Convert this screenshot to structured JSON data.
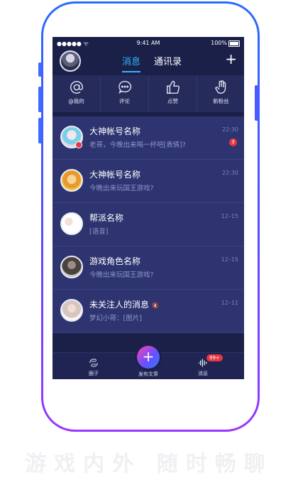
{
  "status": {
    "signal": "●●●●● ᯤ",
    "time": "9:41 AM",
    "battery": "100%"
  },
  "header": {
    "tabs": [
      {
        "label": "消息",
        "active": true
      },
      {
        "label": "通讯录",
        "active": false
      }
    ],
    "add_icon": "plus-icon"
  },
  "quick": [
    {
      "label": "@我的",
      "icon": "at-icon"
    },
    {
      "label": "评论",
      "icon": "comment-icon"
    },
    {
      "label": "点赞",
      "icon": "thumbs-up-icon"
    },
    {
      "label": "新粉丝",
      "icon": "hand-icon"
    }
  ],
  "chats": [
    {
      "name": "大神帐号名称",
      "message": "老哥，今晚出来喝一杯吧[表情]?",
      "time": "22:30",
      "unread": "3"
    },
    {
      "name": "大神帐号名称",
      "message": "今晚出来玩国王游戏?",
      "time": "22:30"
    },
    {
      "name": "帮派名称",
      "message": "[语音]",
      "time": "12–15"
    },
    {
      "name": "游戏角色名称",
      "message": "今晚出来玩国王游戏?",
      "time": "12–15"
    },
    {
      "name": "未关注人的消息",
      "message": "梦幻小哥：[图片]",
      "time": "12–11"
    }
  ],
  "bottom_nav": {
    "circle": "圈子",
    "post": "发布文章",
    "messages": "消息",
    "messages_badge": "99+"
  },
  "slogan": "游戏内外 随时畅聊",
  "colors": {
    "accent": "#31b5ff",
    "background": "#1b2049",
    "badge": "#e6363f",
    "frame": "#5a4cff"
  }
}
